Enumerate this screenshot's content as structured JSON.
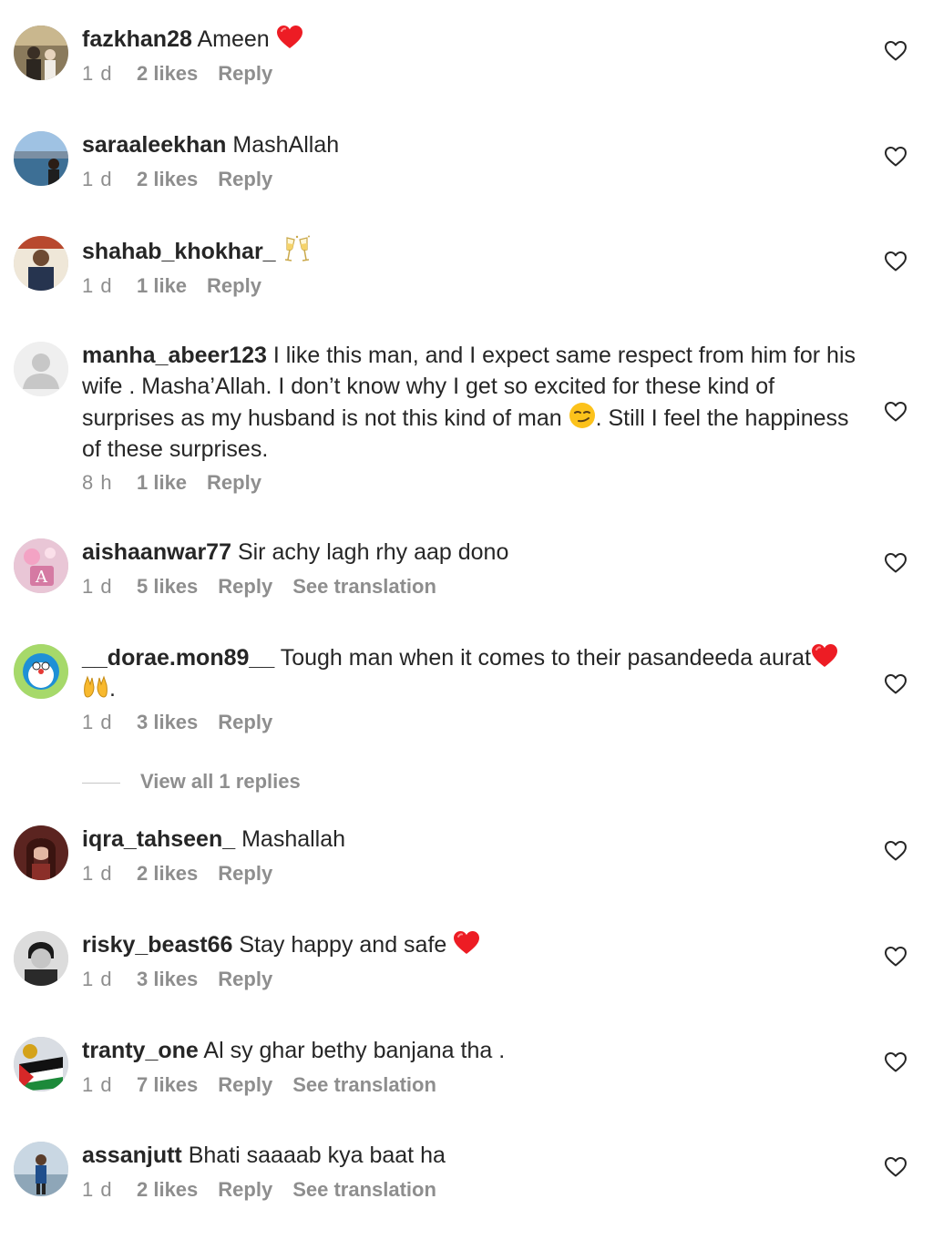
{
  "comments": [
    {
      "username": "fazkhan28",
      "text": "Ameen",
      "time": "1 d",
      "likes": "2 likes",
      "reply": "Reply",
      "emoji": "red-heart"
    },
    {
      "username": "saraaleekhan",
      "text": "MashAllah",
      "time": "1 d",
      "likes": "2 likes",
      "reply": "Reply"
    },
    {
      "username": "shahab_khokhar_",
      "text": "",
      "time": "1 d",
      "likes": "1 like",
      "reply": "Reply",
      "emoji": "clinking-glasses"
    },
    {
      "username": "manha_abeer123",
      "text_a": "I like this man, and I expect same respect from him for his wife . Masha’Allah. I don’t know why I get so excited for these kind of surprises as my husband is not this kind of man",
      "text_b": ". Still I feel the happiness of these surprises.",
      "time": "8 h",
      "likes": "1 like",
      "reply": "Reply",
      "emoji": "smirking-face"
    },
    {
      "username": "aishaanwar77",
      "text": "Sir achy lagh rhy aap dono",
      "time": "1 d",
      "likes": "5 likes",
      "reply": "Reply",
      "translate": "See translation"
    },
    {
      "username": "__dorae.mon89__",
      "text_a": "Tough man when it comes to their pasandeeda aurat",
      "text_b": ".",
      "time": "1 d",
      "likes": "3 likes",
      "reply": "Reply",
      "emoji": "red-heart, raising-hands"
    },
    {
      "username": "iqra_tahseen_",
      "text": "Mashallah",
      "time": "1 d",
      "likes": "2 likes",
      "reply": "Reply"
    },
    {
      "username": "risky_beast66",
      "text": "Stay happy and safe",
      "time": "1 d",
      "likes": "3 likes",
      "reply": "Reply",
      "emoji": "red-heart"
    },
    {
      "username": "tranty_one",
      "text": "Al sy ghar bethy banjana tha .",
      "time": "1 d",
      "likes": "7 likes",
      "reply": "Reply",
      "translate": "See translation"
    },
    {
      "username": "assanjutt",
      "text": "Bhati saaaab kya baat ha",
      "time": "1 d",
      "likes": "2 likes",
      "reply": "Reply",
      "translate": "See translation"
    }
  ],
  "view_replies": "View all 1 replies",
  "icons": {
    "like": "heart-outline-icon"
  },
  "colors": {
    "text": "#262626",
    "secondary": "#8e8e8e",
    "heart": "#ed1c24"
  }
}
